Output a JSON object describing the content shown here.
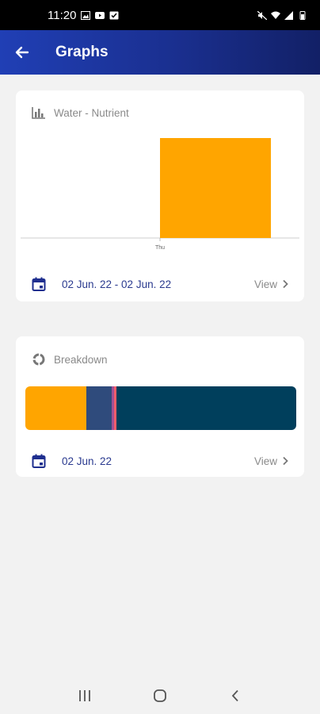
{
  "status_bar": {
    "time": "11:20"
  },
  "app_bar": {
    "title": "Graphs"
  },
  "graph_card": {
    "title": "Water - Nutrient",
    "date_range": "02 Jun. 22 - 02 Jun. 22",
    "view_label": "View"
  },
  "breakdown_card": {
    "title": "Breakdown",
    "date": "02 Jun. 22",
    "view_label": "View",
    "segments": [
      {
        "fraction": 0.225,
        "color": "#FFA500"
      },
      {
        "fraction": 0.095,
        "color": "#2F4B7C"
      },
      {
        "fraction": 0.008,
        "color": "#A05195"
      },
      {
        "fraction": 0.007,
        "color": "#F95D6A"
      },
      {
        "fraction": 0.665,
        "color": "#003F5C"
      }
    ]
  },
  "chart_data": {
    "type": "bar",
    "categories": [
      "Thu"
    ],
    "values": [
      1
    ],
    "ylim": [
      0,
      1
    ],
    "color": "#FFA500",
    "xlabel": "",
    "ylabel": "",
    "grid": false
  },
  "colors": {
    "accent": "#203FB5",
    "date_text": "#2A3A8F",
    "background": "#F2F2F2"
  }
}
